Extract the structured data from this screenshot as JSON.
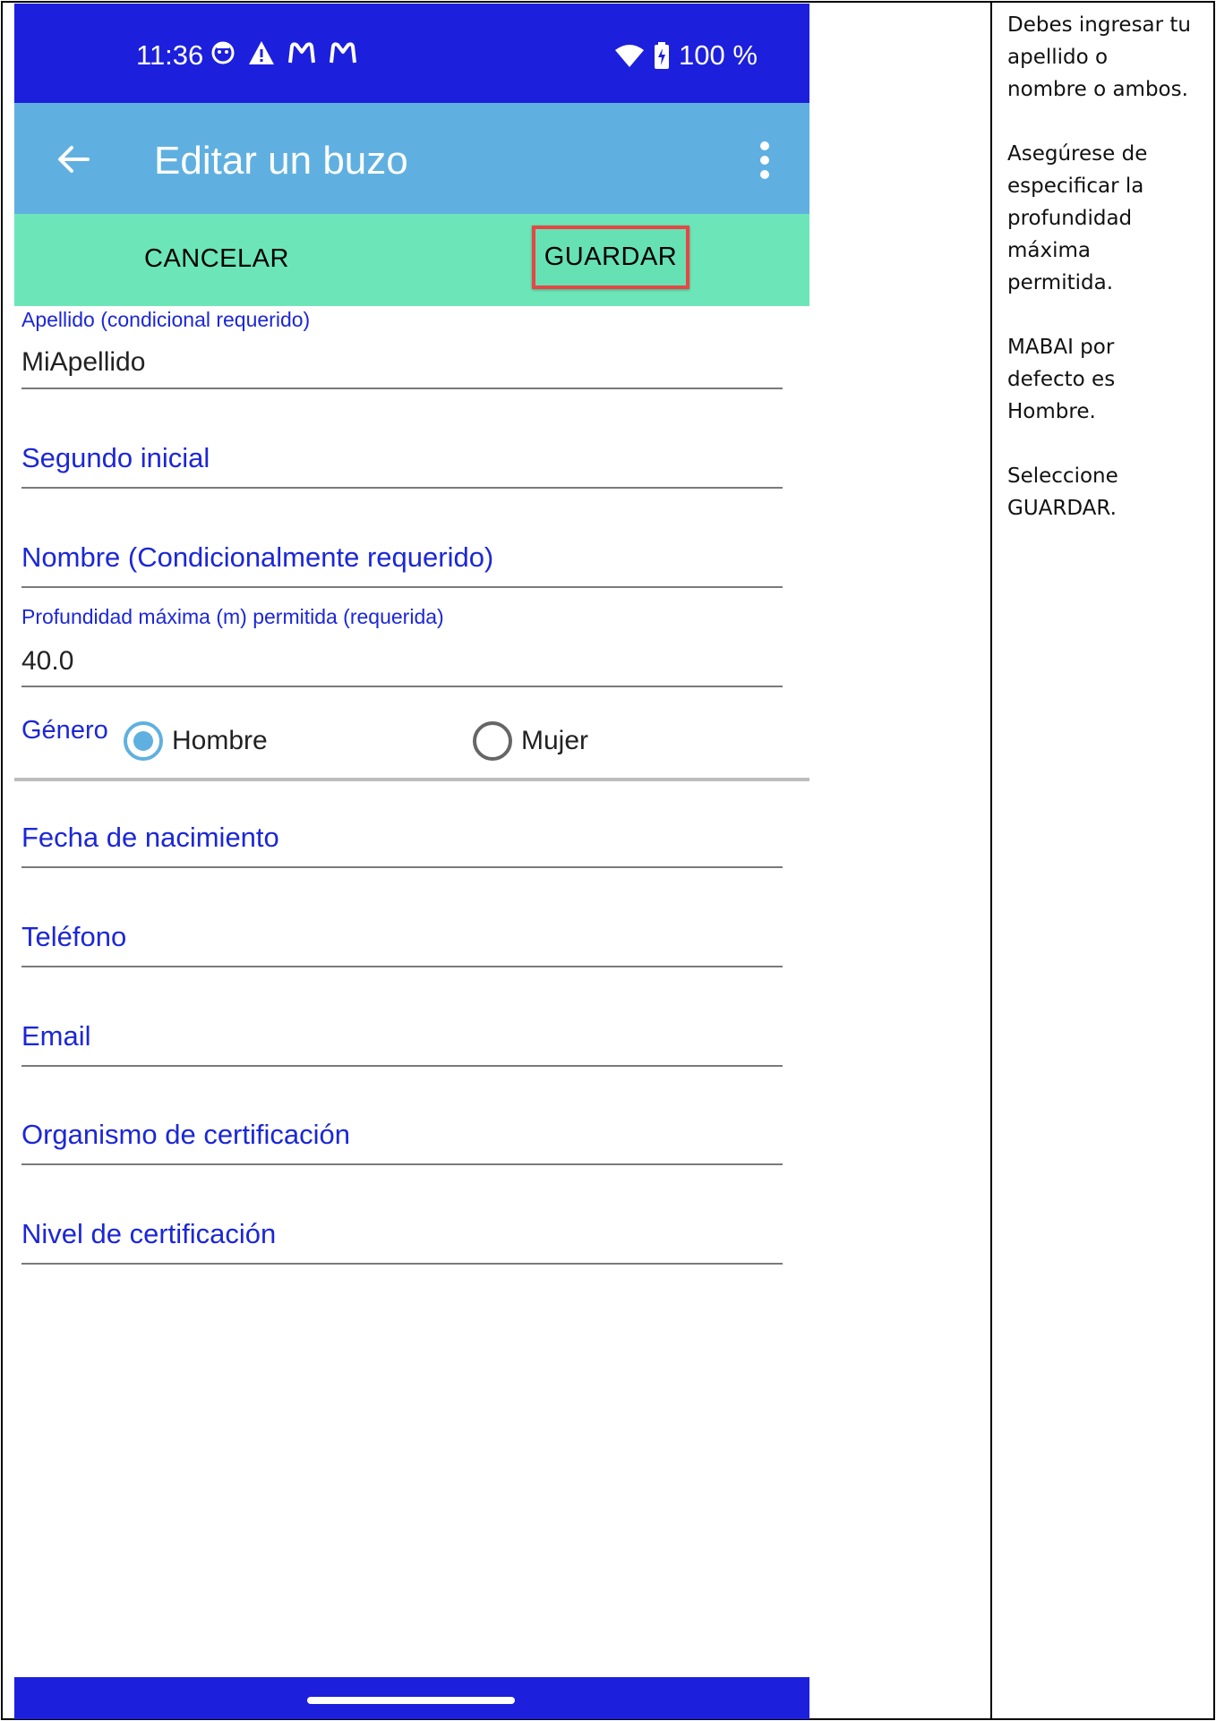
{
  "statusbar": {
    "time": "11:36",
    "battery_pct": "100 %",
    "left_icons": [
      "face-icon",
      "warning-icon",
      "malwarebytes-icon",
      "malwarebytes-icon"
    ],
    "right_icons": [
      "wifi-icon",
      "battery-charging-icon"
    ]
  },
  "appbar": {
    "title": "Editar un buzo",
    "color": "#5fb0e0"
  },
  "actions": {
    "cancel": "CANCELAR",
    "save": "GUARDAR",
    "highlight_color": "#e84545",
    "bar_color": "#6ce6b8"
  },
  "form": {
    "last_name": {
      "label": "Apellido (condicional requerido)",
      "value": "MiApellido"
    },
    "middle_initial": {
      "hint": "Segundo inicial"
    },
    "first_name": {
      "hint": "Nombre (Condicionalmente requerido)"
    },
    "max_depth": {
      "label": "Profundidad máxima (m) permitida (requerida)",
      "value": "40.0"
    },
    "gender": {
      "label": "Género",
      "options": [
        "Hombre",
        "Mujer"
      ],
      "selected": "Hombre"
    },
    "birth_date": {
      "hint": "Fecha de nacimiento"
    },
    "phone": {
      "hint": "Teléfono"
    },
    "email": {
      "hint": "Email"
    },
    "cert_agency": {
      "hint": "Organismo de certificación"
    },
    "cert_level": {
      "hint": "Nivel de certificación"
    }
  },
  "notes": {
    "lines_1": [
      "Debes ingresar tu",
      "apellido o",
      "nombre o ambos."
    ],
    "lines_2": [
      "Asegúrese de",
      "especificar la",
      "profundidad",
      "máxima",
      "permitida."
    ],
    "lines_3": [
      "MABAI por",
      "defecto es",
      "Hombre."
    ],
    "lines_4": [
      "Seleccione",
      "GUARDAR."
    ]
  }
}
